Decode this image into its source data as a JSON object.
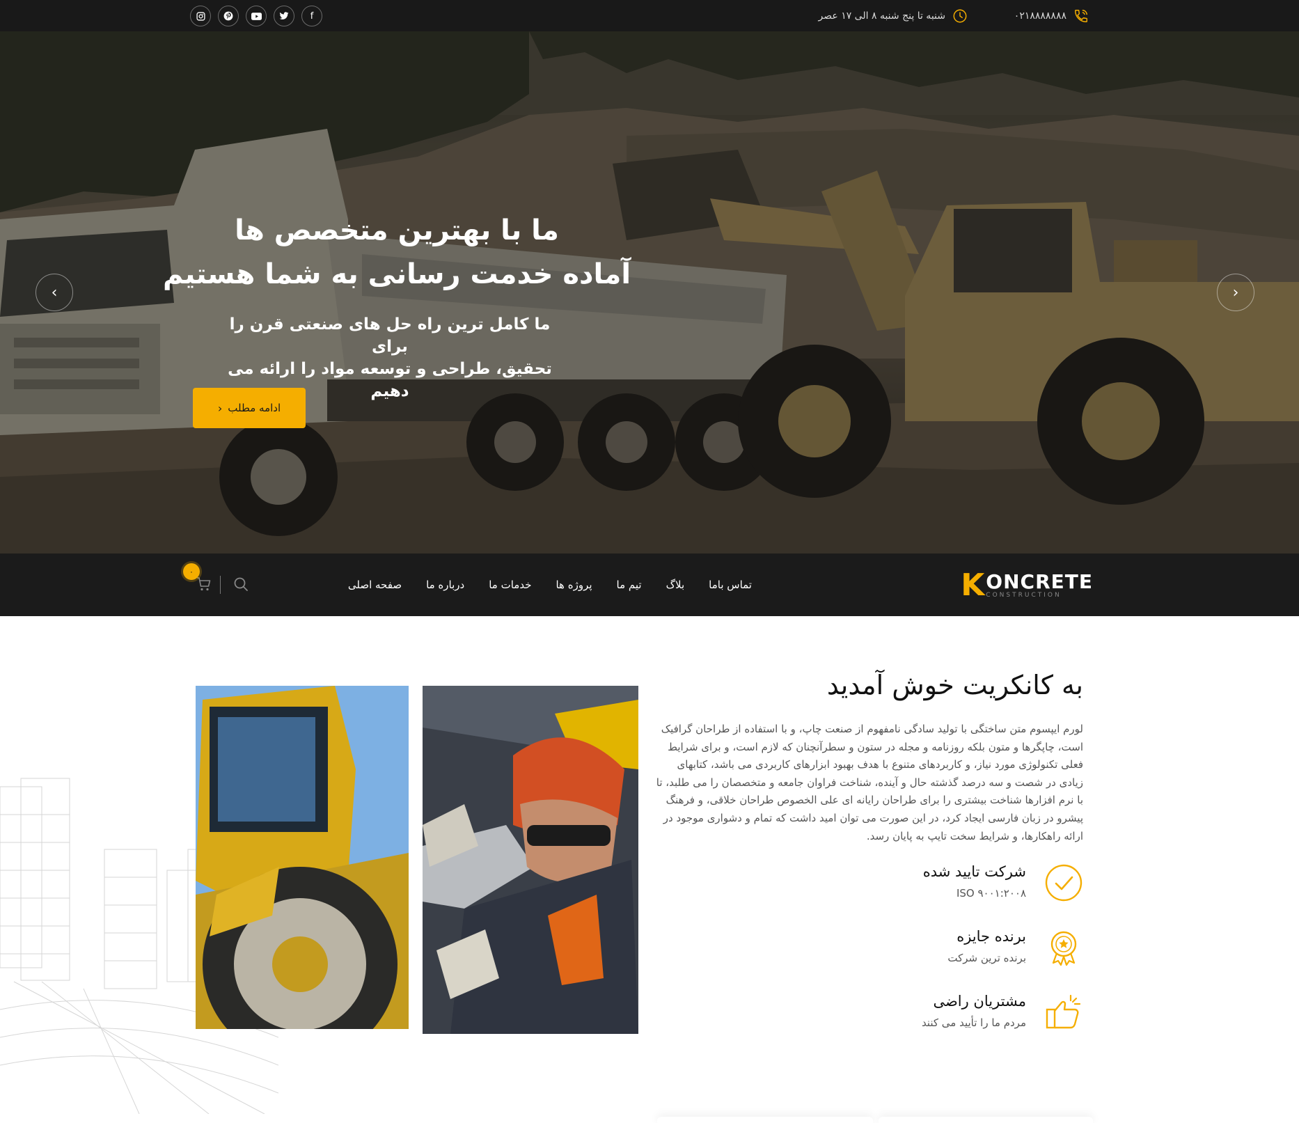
{
  "topbar": {
    "phone": "۰۲۱۸۸۸۸۸۸۸",
    "phone_icon": "phone-icon",
    "hours": "شنبه تا پنج شنبه ۸ الی ۱۷ عصر",
    "hours_icon": "clock-icon",
    "social": [
      {
        "icon": "facebook-icon",
        "glyph": "f"
      },
      {
        "icon": "twitter-icon",
        "glyph": "t"
      },
      {
        "icon": "youtube-icon",
        "glyph": "▶"
      },
      {
        "icon": "pinterest-icon",
        "glyph": "p"
      },
      {
        "icon": "instagram-icon",
        "glyph": "◎"
      }
    ]
  },
  "hero": {
    "title_line1": "ما با بهترین متخصص ها",
    "title_line2": "آماده خدمت رسانی به شما هستیم",
    "subtitle_line1": "ما کامل ترین راه حل های صنعتی قرن را برای",
    "subtitle_line2": "تحقیق، طراحی و توسعه مواد را ارائه می دهیم",
    "button_label": "ادامه مطلب",
    "button_icon": "chevron-left-icon",
    "prev_icon": "chevron-left-icon",
    "next_icon": "chevron-right-icon"
  },
  "nav": {
    "logo_letter": "K",
    "logo_main": "ONCRETE",
    "logo_sub": "CONSTRUCTION",
    "menu": [
      "صفحه اصلی",
      "درباره ما",
      "خدمات ما",
      "پروژه ها",
      "تیم ما",
      "بلاگ",
      "تماس باما"
    ],
    "search_icon": "search-icon",
    "cart_icon": "cart-icon",
    "cart_count": "۰"
  },
  "welcome": {
    "title": "به کانکریت خوش آمدید",
    "body": "لورم ایپسوم متن ساختگی با تولید سادگی نامفهوم از صنعت چاپ، و با استفاده از طراحان گرافیک است، چاپگرها و متون بلکه روزنامه و مجله در ستون و سطرآنچنان که لازم است، و برای شرایط فعلی تکنولوژی مورد نیاز، و کاربردهای متنوع با هدف بهبود ابزارهای کاربردی می باشد، کتابهای زیادی در شصت و سه درصد گذشته حال و آینده، شناخت فراوان جامعه و متخصصان را می طلبد، تا با نرم افزارها شناخت بیشتری را برای طراحان رایانه ای علی الخصوص طراحان خلاقی، و فرهنگ پیشرو در زبان فارسی ایجاد کرد، در این صورت می توان امید داشت که تمام و دشواری موجود در ارائه راهکارها، و شرایط سخت تایپ به پایان رسد.",
    "features": [
      {
        "icon": "check-circle-icon",
        "title": "شرکت تایید شده",
        "subtitle": "ISO ۹۰۰۱:۲۰۰۸"
      },
      {
        "icon": "award-badge-icon",
        "title": "برنده جایزه",
        "subtitle": "برنده ترین شرکت"
      },
      {
        "icon": "thumbs-up-icon",
        "title": "مشتریان راضی",
        "subtitle": "مردم ما را تأیید می کنند"
      }
    ]
  },
  "colors": {
    "accent": "#f5ae00",
    "dark": "#1b1b1b",
    "topbar": "#191919"
  }
}
